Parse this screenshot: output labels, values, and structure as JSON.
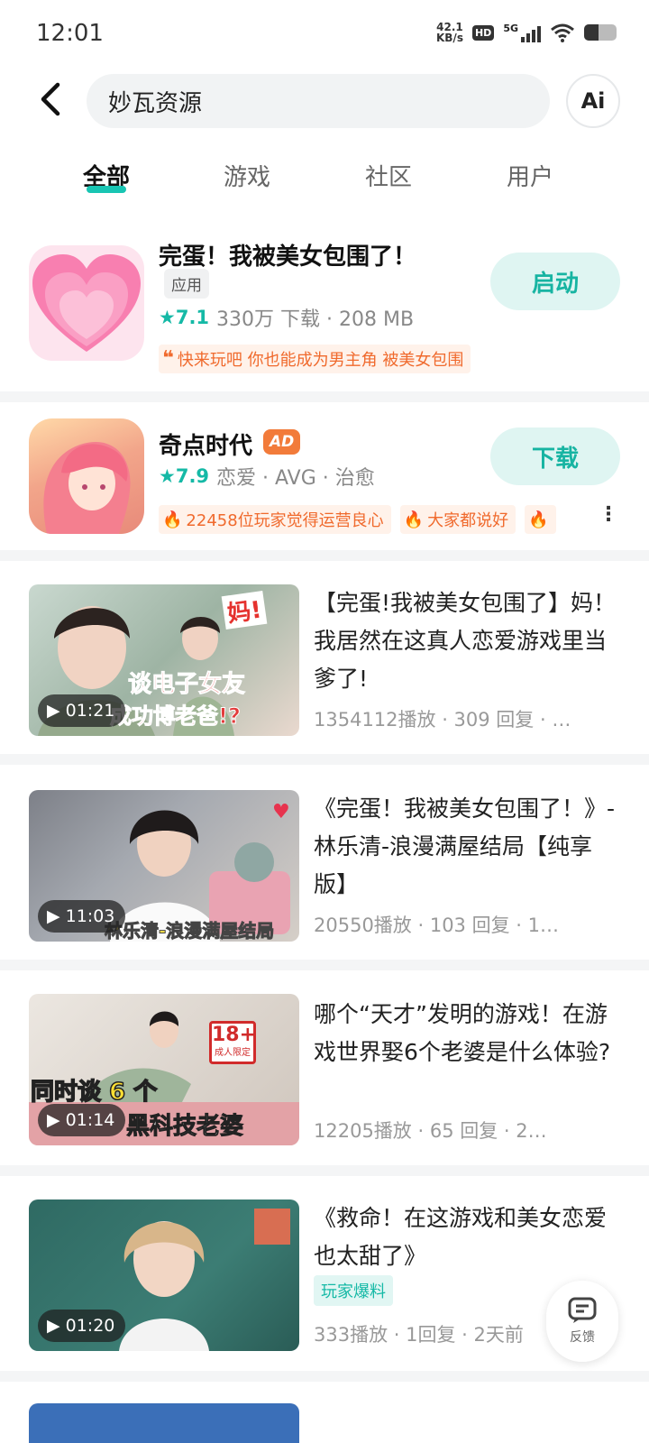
{
  "status_bar": {
    "time": "12:01",
    "net_speed_value": "42.1",
    "net_speed_unit": "KB/s",
    "hd": "HD",
    "network": "5G",
    "battery_level": 0.45
  },
  "search": {
    "query": "妙瓦资源",
    "ai_label": "Ai"
  },
  "tabs": [
    {
      "label": "全部",
      "active": true
    },
    {
      "label": "游戏",
      "active": false
    },
    {
      "label": "社区",
      "active": false
    },
    {
      "label": "用户",
      "active": false
    }
  ],
  "apps": [
    {
      "title": "完蛋！我被美女包围了！",
      "chip": "应用",
      "rating": "7.1",
      "meta": "330万 下载 · 208 MB",
      "action": "启动",
      "tags": [
        "快来玩吧 你也能成为男主角 被美女包围"
      ]
    },
    {
      "title": "奇点时代",
      "chip": "AD",
      "rating": "7.9",
      "meta": "恋爱 · AVG · 治愈",
      "action": "下载",
      "tags": [
        "22458位玩家觉得运营良心",
        "大家都说好"
      ]
    }
  ],
  "videos": [
    {
      "title": "【完蛋!我被美女包围了】妈！我居然在这真人恋爱游戏里当爹了!",
      "meta": "1354112播放 · 309 回复 · …",
      "duration": "01:21",
      "overlay": [
        "妈!",
        "谈电子女友",
        "成功博老爸!?"
      ]
    },
    {
      "title": "《完蛋！我被美女包围了！》-林乐清-浪漫满屋结局【纯享版】",
      "meta": "20550播放 · 103 回复 · 1…",
      "duration": "11:03",
      "overlay": [
        "林乐清-浪漫满屋结局"
      ]
    },
    {
      "title": "哪个“天才”发明的游戏！在游戏世界娶6个老婆是什么体验?",
      "meta": "12205播放 · 65 回复 · 2…",
      "duration": "01:14",
      "overlay": [
        "同时谈 6 个",
        "黑科技老婆",
        "18+",
        "成人限定"
      ]
    },
    {
      "title": "《救命！在这游戏和美女恋爱也太甜了》",
      "tag": "玩家爆料",
      "meta": "333播放 · 1回复 · 2天前",
      "duration": "01:20",
      "overlay": []
    }
  ],
  "feedback_label": "反馈",
  "colors": {
    "accent": "#15b9a6",
    "orange": "#f06a2d"
  }
}
